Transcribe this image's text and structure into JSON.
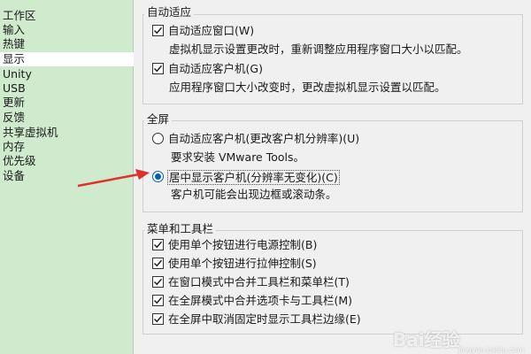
{
  "sidebar": {
    "items": [
      {
        "label": "工作区"
      },
      {
        "label": "输入"
      },
      {
        "label": "热键"
      },
      {
        "label": "显示",
        "selected": true
      },
      {
        "label": "Unity"
      },
      {
        "label": "USB"
      },
      {
        "label": "更新"
      },
      {
        "label": "反馈"
      },
      {
        "label": "共享虚拟机"
      },
      {
        "label": "内存"
      },
      {
        "label": "优先级"
      },
      {
        "label": "设备"
      }
    ]
  },
  "auto_fit": {
    "title": "自动适应",
    "window": {
      "label": "自动适应窗口(W)",
      "checked": true,
      "desc": "虚拟机显示设置更改时，重新调整应用程序窗口大小以匹配。"
    },
    "guest": {
      "label": "自动适应客户机(G)",
      "checked": true,
      "desc": "应用程序窗口大小改变时，更改虚拟机显示设置以匹配。"
    }
  },
  "fullscreen": {
    "title": "全屏",
    "option1": {
      "label": "自动适应客户机(更改客户机分辨率)(U)",
      "checked": false,
      "desc": "要求安装 VMware Tools。"
    },
    "option2": {
      "label": "居中显示客户机(分辨率无变化)(C)",
      "checked": true,
      "desc": "客户机可能会出现边框或滚动条。"
    }
  },
  "menu_toolbar": {
    "title": "菜单和工具栏",
    "items": [
      {
        "label": "使用单个按钮进行电源控制(B)",
        "checked": true
      },
      {
        "label": "使用单个按钮进行拉伸控制(S)",
        "checked": true
      },
      {
        "label": "在窗口模式中合并工具栏和菜单栏(T)",
        "checked": true
      },
      {
        "label": "在全屏模式中合并选项卡与工具栏(M)",
        "checked": true
      },
      {
        "label": "在全屏中取消固定时显示工具栏边缘(E)",
        "checked": true
      }
    ]
  },
  "annotation": {
    "arrow_color": "#e0302a"
  },
  "watermark": {
    "text": "Bai经验",
    "sub": "jingyan.baidu.com"
  }
}
